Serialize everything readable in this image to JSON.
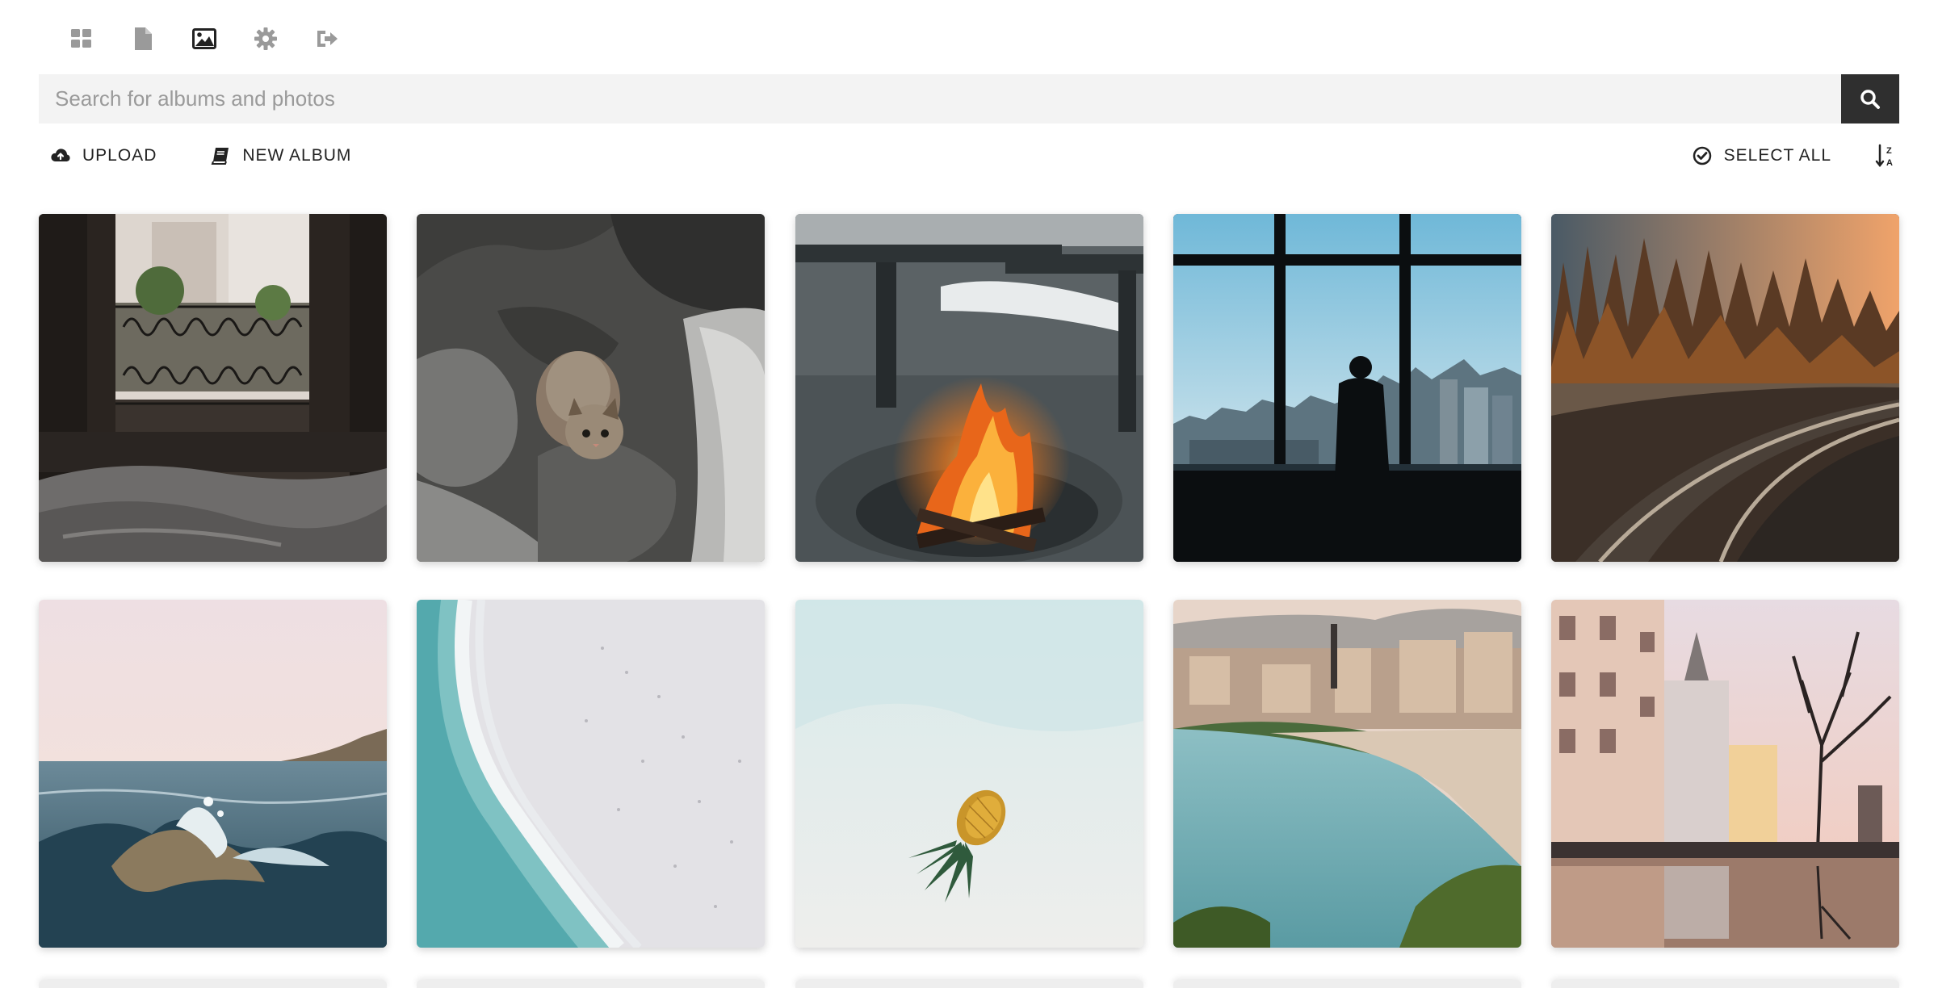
{
  "nav": {
    "items": [
      {
        "name": "dashboard-icon",
        "label": "Dashboard"
      },
      {
        "name": "document-icon",
        "label": "Pages"
      },
      {
        "name": "image-icon",
        "label": "Gallery"
      },
      {
        "name": "gear-icon",
        "label": "Settings"
      },
      {
        "name": "logout-icon",
        "label": "Logout"
      }
    ],
    "active": "image-icon"
  },
  "search": {
    "placeholder": "Search for albums and photos",
    "value": ""
  },
  "toolbar": {
    "upload_label": "UPLOAD",
    "new_album_label": "NEW ALBUM",
    "select_all_label": "SELECT ALL",
    "sort_icon": "sort-alpha-desc-icon"
  },
  "photos": [
    {
      "subject": "bedroom window with balcony railing"
    },
    {
      "subject": "kitten on grey bedding"
    },
    {
      "subject": "campfire in stone fire pit"
    },
    {
      "subject": "silhouette at city window"
    },
    {
      "subject": "railway track through autumn forest at sunset"
    },
    {
      "subject": "ocean wave at dusk"
    },
    {
      "subject": "aerial beach shoreline"
    },
    {
      "subject": "pineapple on white sand"
    },
    {
      "subject": "crowded city beach"
    },
    {
      "subject": "street with reflection puddle and bare tree"
    }
  ],
  "colors": {
    "search_bg": "#f3f3f3",
    "search_button": "#2f2f2f",
    "icon_grey": "#9a9a9a",
    "icon_dark": "#222222"
  }
}
